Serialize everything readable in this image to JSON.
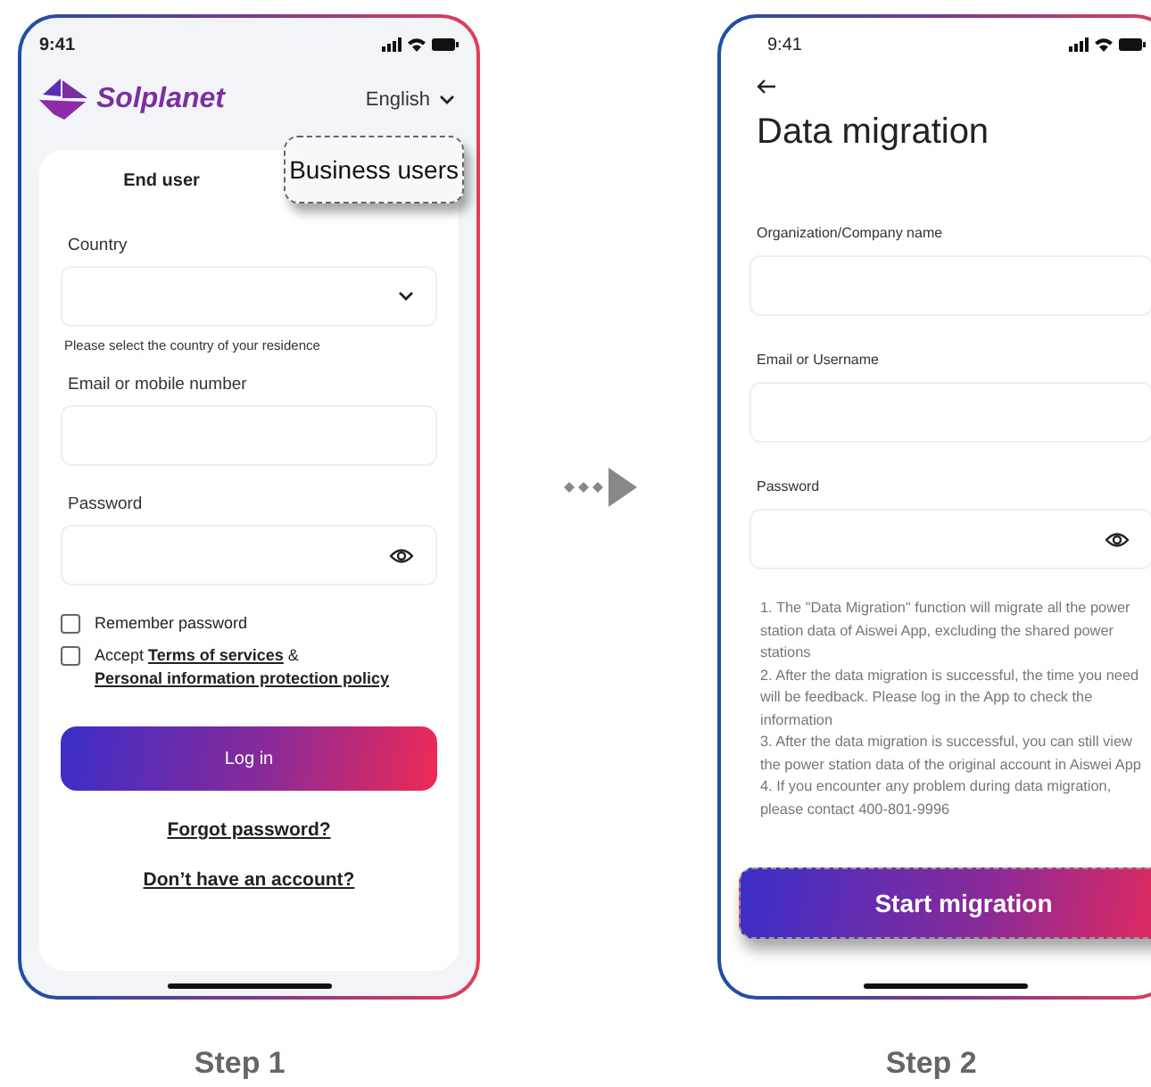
{
  "step1": {
    "status_time": "9:41",
    "brand": "Solplanet",
    "language": "English",
    "tabs": [
      {
        "label": "End user",
        "selected": true,
        "highlighted": false
      },
      {
        "label": "Business users",
        "selected": false,
        "highlighted": true
      }
    ],
    "fields": [
      {
        "label": "Country",
        "kind": "select",
        "hint": "Please select the country of your residence"
      },
      {
        "label": "Email or mobile number",
        "kind": "text"
      },
      {
        "label": "Password",
        "kind": "password"
      }
    ],
    "checkboxes": [
      {
        "checked": false,
        "parts": [
          {
            "text": "Remember password",
            "link": false
          }
        ]
      },
      {
        "checked": false,
        "parts": [
          {
            "text": "Accept ",
            "link": false
          },
          {
            "text": "Terms of services",
            "link": true
          },
          {
            "text": " & ",
            "link": false
          },
          {
            "text": "Personal information protection policy",
            "link": true
          }
        ]
      }
    ],
    "login_button": "Log in",
    "links": [
      "Forgot password?",
      "Don’t have an account?"
    ],
    "caption": "Step 1"
  },
  "step2": {
    "status_time": "9:41",
    "title": "Data migration",
    "fields": [
      {
        "label": "Organization/Company name",
        "kind": "text"
      },
      {
        "label": "Email or Username",
        "kind": "text"
      },
      {
        "label": "Password",
        "kind": "password"
      }
    ],
    "notes": [
      "1. The \"Data Migration\" function will migrate all the power station data of Aiswei App, excluding the shared power stations",
      "2. After the data migration is successful, the time you need will be feedback. Please log in the App to check the information",
      "3. After the data migration is successful, you can still view the power station data of the original account in Aiswei App",
      "4. If you encounter any problem during data migration, please contact 400-801-9996"
    ],
    "button": {
      "label": "Start migration",
      "highlighted": true
    },
    "caption": "Step 2"
  }
}
